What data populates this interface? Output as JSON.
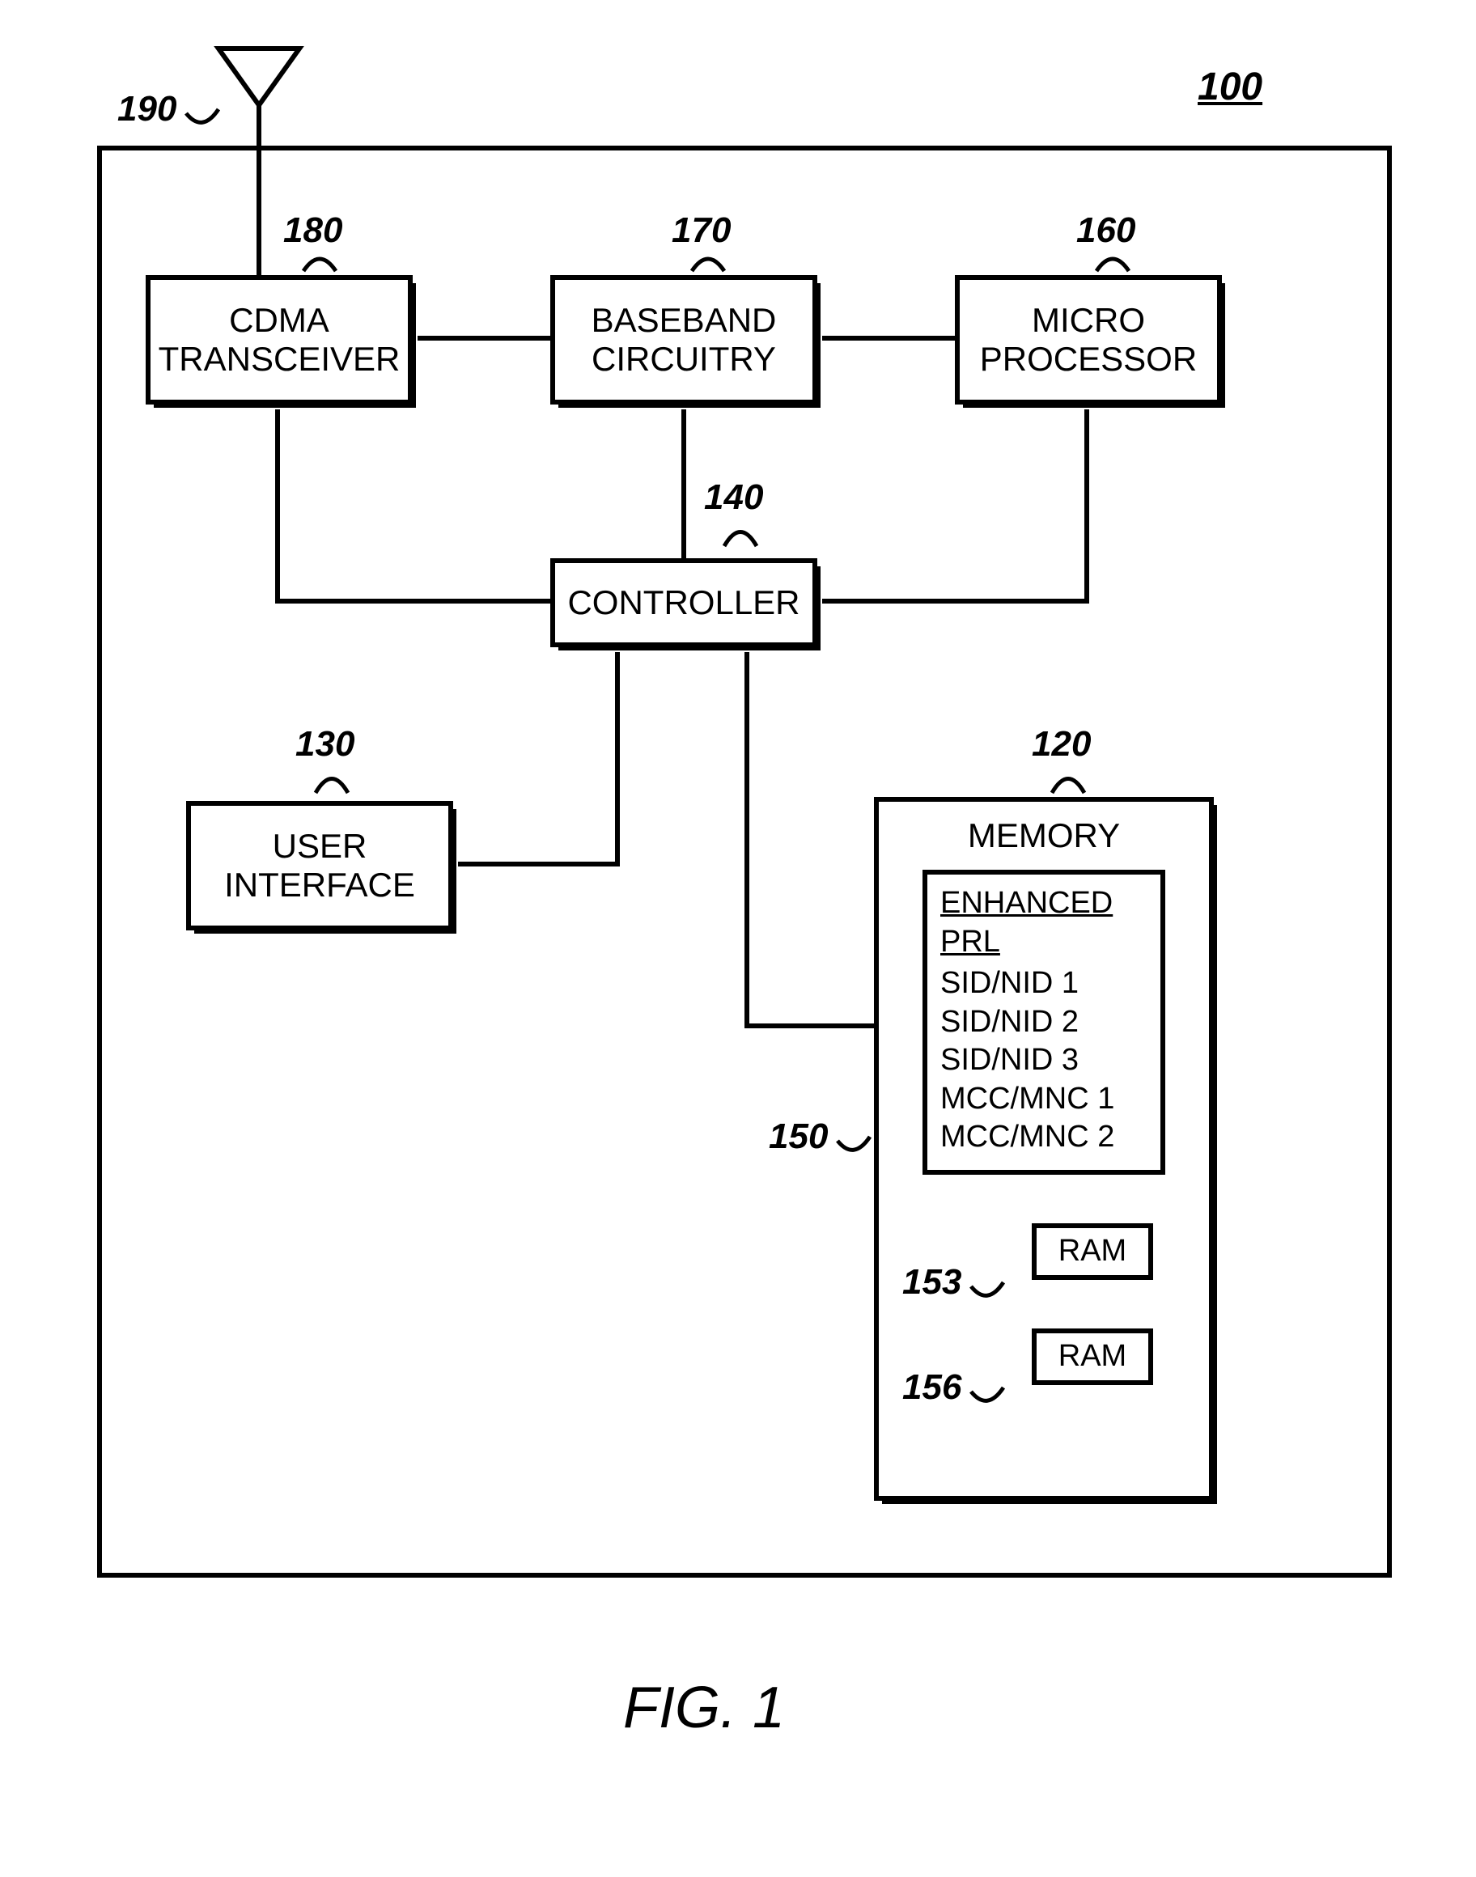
{
  "figure": {
    "ref_100": "100",
    "caption": "FIG. 1"
  },
  "antenna": {
    "ref": "190"
  },
  "blocks": {
    "transceiver": {
      "ref": "180",
      "line1": "CDMA",
      "line2": "TRANSCEIVER"
    },
    "baseband": {
      "ref": "170",
      "line1": "BASEBAND",
      "line2": "CIRCUITRY"
    },
    "micro": {
      "ref": "160",
      "line1": "MICRO",
      "line2": "PROCESSOR"
    },
    "controller": {
      "ref": "140",
      "label": "CONTROLLER"
    },
    "ui": {
      "ref": "130",
      "line1": "USER",
      "line2": "INTERFACE"
    }
  },
  "memory": {
    "ref": "120",
    "title": "MEMORY",
    "prl": {
      "ref": "150",
      "title": "ENHANCED PRL",
      "items": [
        "SID/NID 1",
        "SID/NID 2",
        "SID/NID 3",
        "MCC/MNC 1",
        "MCC/MNC 2"
      ]
    },
    "ram1": {
      "ref": "153",
      "label": "RAM"
    },
    "ram2": {
      "ref": "156",
      "label": "RAM"
    }
  }
}
